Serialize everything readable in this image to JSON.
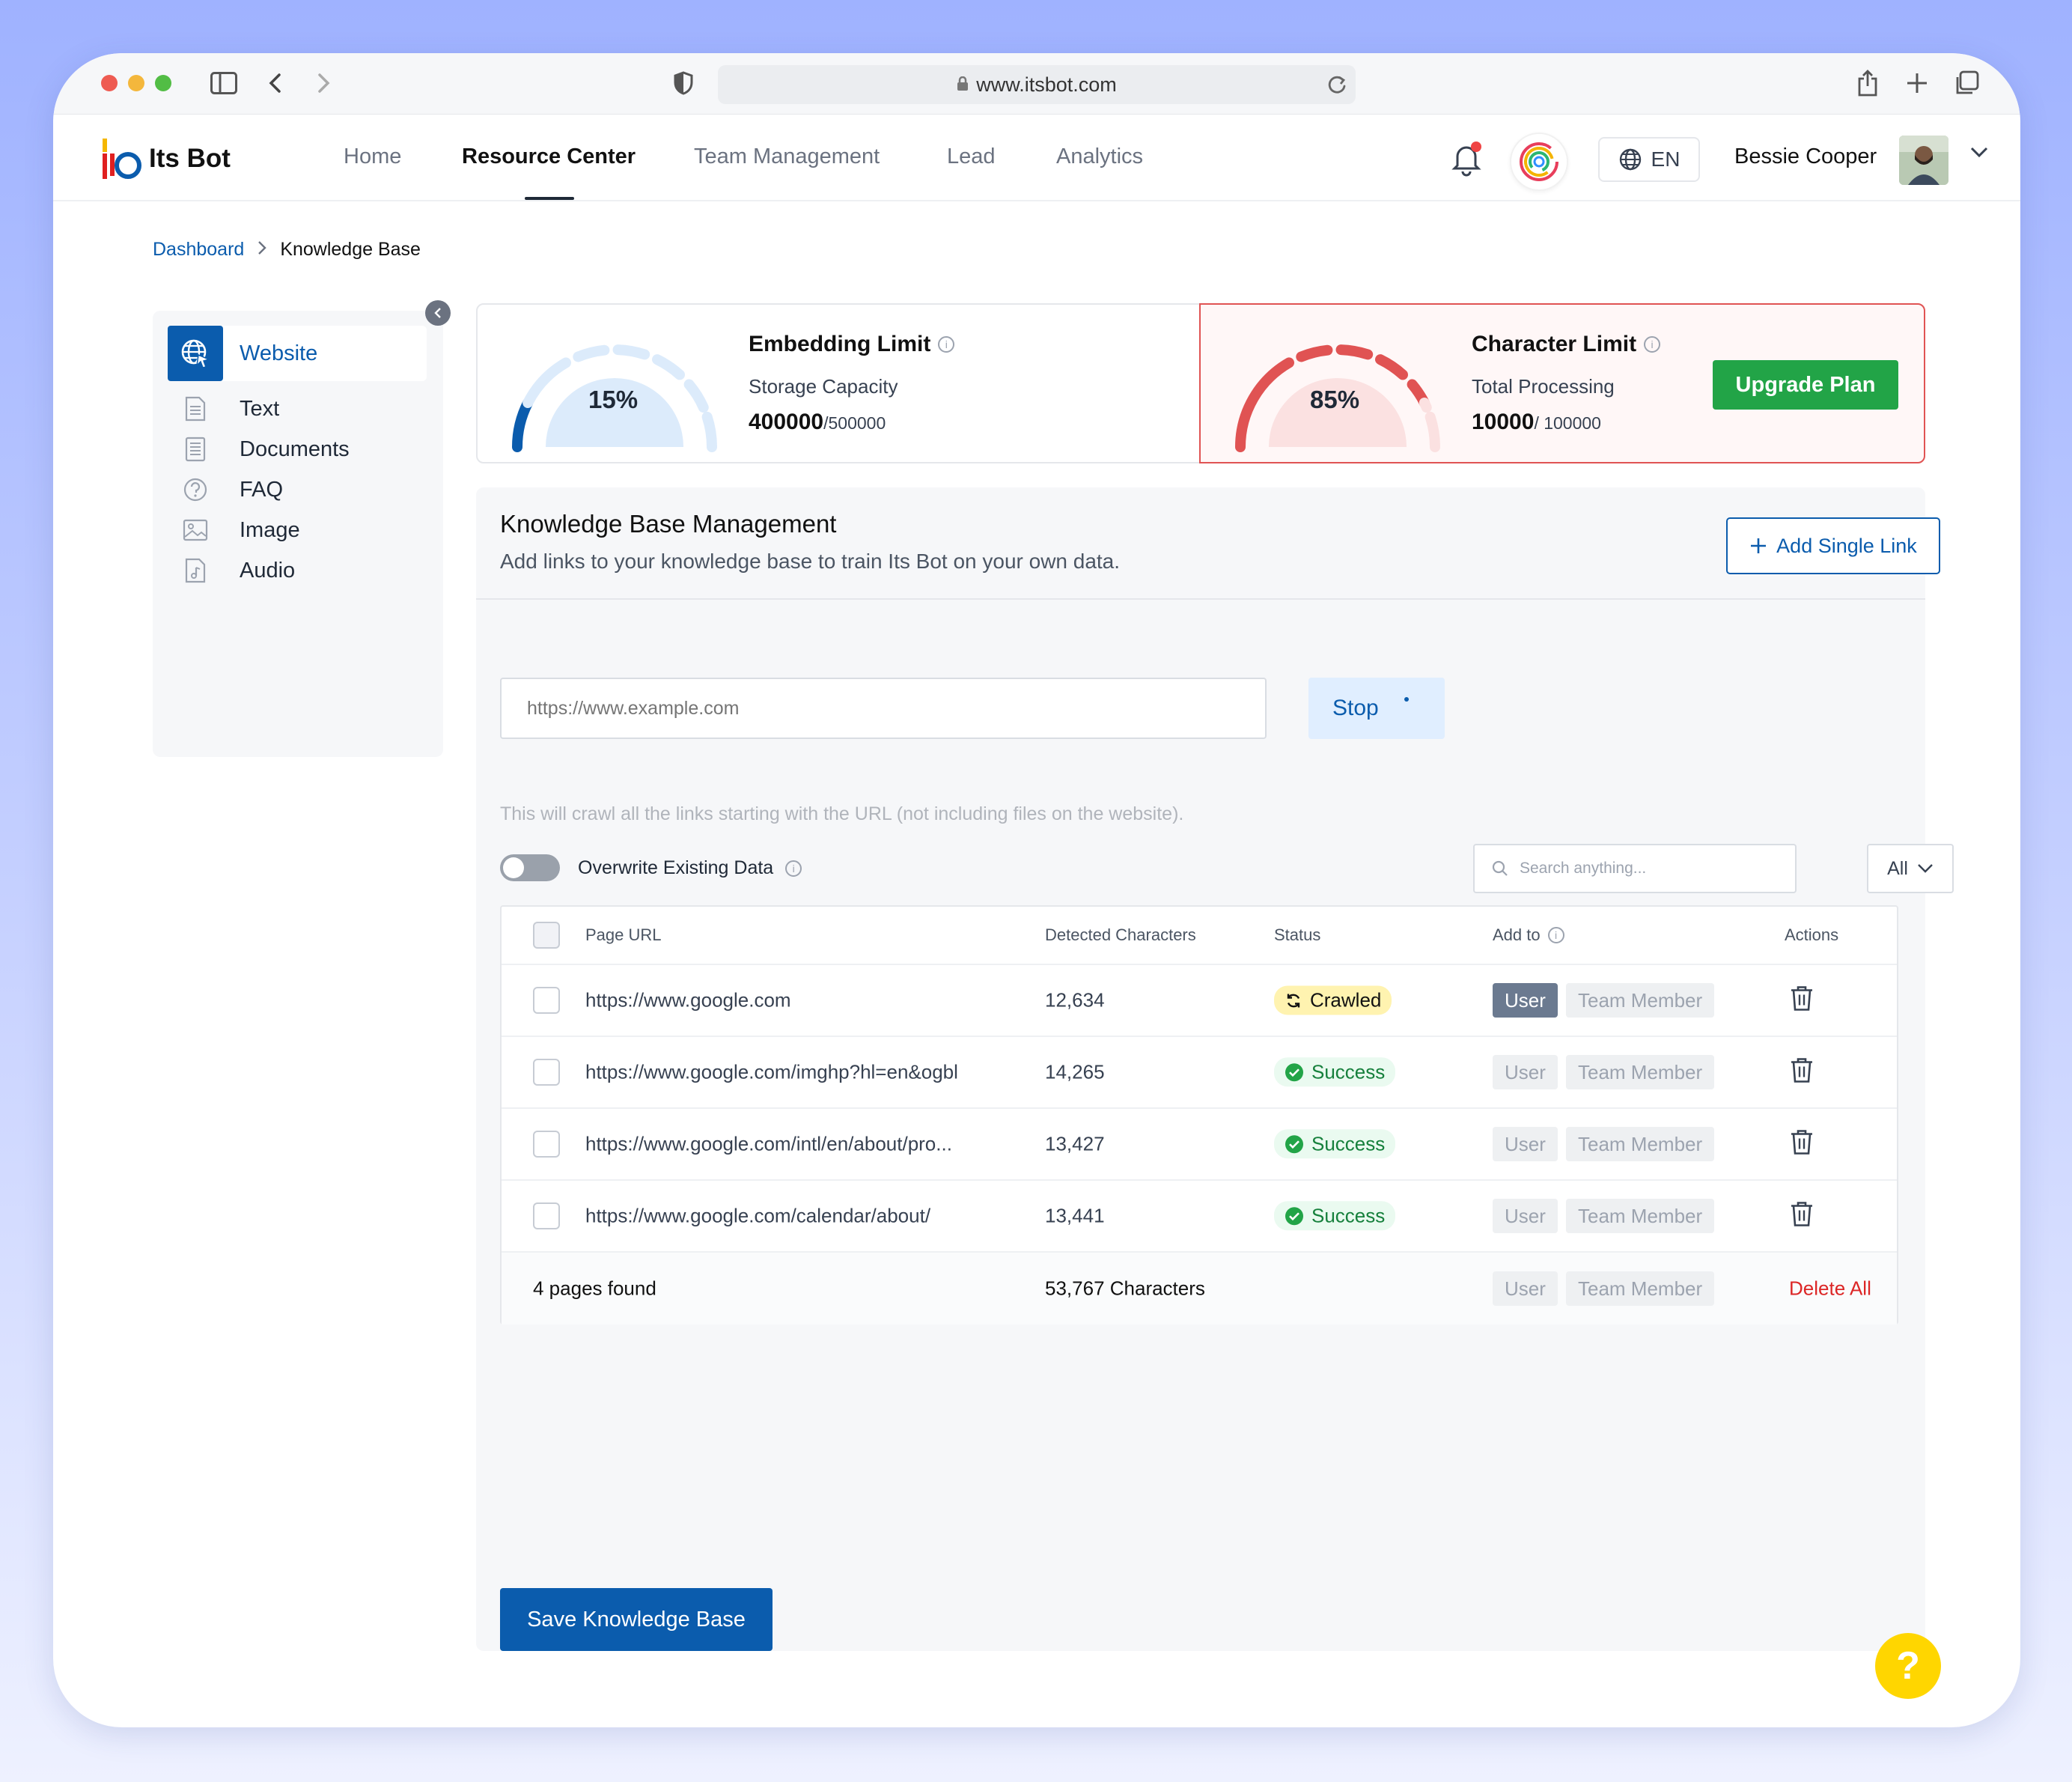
{
  "browser": {
    "url": "www.itsbot.com"
  },
  "app": {
    "name": "Its Bot",
    "nav": [
      "Home",
      "Resource Center",
      "Team Management",
      "Lead",
      "Analytics"
    ],
    "active_nav": "Resource Center",
    "language": "EN",
    "user_name": "Bessie Cooper"
  },
  "breadcrumb": {
    "root": "Dashboard",
    "current": "Knowledge Base"
  },
  "sidebar": {
    "items": [
      {
        "label": "Website",
        "icon": "globe-cursor-icon",
        "active": true
      },
      {
        "label": "Text",
        "icon": "text-file-icon",
        "active": false
      },
      {
        "label": "Documents",
        "icon": "document-icon",
        "active": false
      },
      {
        "label": "FAQ",
        "icon": "question-circle-icon",
        "active": false
      },
      {
        "label": "Image",
        "icon": "image-icon",
        "active": false
      },
      {
        "label": "Audio",
        "icon": "audio-file-icon",
        "active": false
      }
    ]
  },
  "limits": {
    "embedding": {
      "title": "Embedding Limit",
      "percent_label": "15%",
      "percent": 15,
      "subtitle": "Storage Capacity",
      "used": "400000",
      "total": "/500000",
      "color": "#0b5cad"
    },
    "character": {
      "title": "Character Limit",
      "percent_label": "85%",
      "percent": 85,
      "subtitle": "Total Processing",
      "used": "10000",
      "total": "/ 100000",
      "color": "#e05353",
      "cta": "Upgrade Plan"
    }
  },
  "kb": {
    "title": "Knowledge Base Management",
    "subtitle": "Add links to your knowledge base to train Its Bot on your own data.",
    "add_link": "Add Single Link",
    "url_placeholder": "https://www.example.com",
    "stop_label": "Stop",
    "hint": "This will crawl all the links starting with the URL (not including files on the website).",
    "overwrite_label": "Overwrite Existing Data",
    "overwrite_on": false,
    "search_placeholder": "Search anything...",
    "filter_value": "All",
    "columns": [
      "Page URL",
      "Detected Characters",
      "Status",
      "Add to",
      "Actions"
    ],
    "rows": [
      {
        "url": "https://www.google.com",
        "chars": "12,634",
        "status": "Crawled",
        "user": "User",
        "team": "Team Member",
        "user_selected": true
      },
      {
        "url": "https://www.google.com/imghp?hl=en&ogbl",
        "chars": "14,265",
        "status": "Success",
        "user": "User",
        "team": "Team Member",
        "user_selected": false
      },
      {
        "url": "https://www.google.com/intl/en/about/pro...",
        "chars": "13,427",
        "status": "Success",
        "user": "User",
        "team": "Team Member",
        "user_selected": false
      },
      {
        "url": "https://www.google.com/calendar/about/",
        "chars": "13,441",
        "status": "Success",
        "user": "User",
        "team": "Team Member",
        "user_selected": false
      }
    ],
    "footer": {
      "pages_found": "4 pages found",
      "total_chars": "53,767 Characters",
      "user": "User",
      "team": "Team Member",
      "delete_all": "Delete All"
    },
    "save_label": "Save Knowledge Base"
  },
  "help_label": "?"
}
